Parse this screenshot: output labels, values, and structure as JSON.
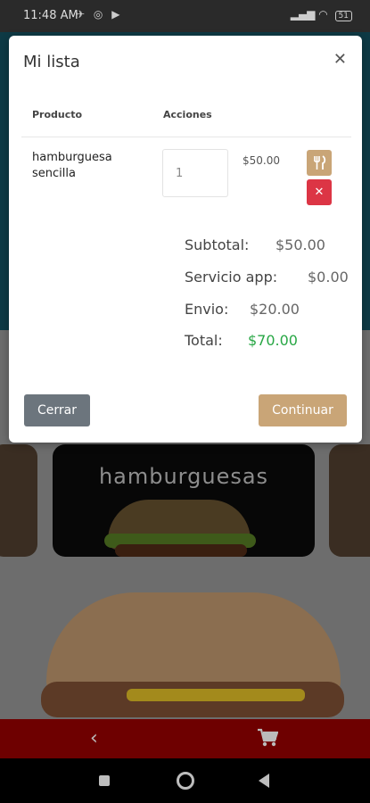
{
  "status_bar": {
    "time": "11:48 AM",
    "icons": [
      "bluetooth-off-icon",
      "whatsapp-icon",
      "youtube-icon"
    ],
    "battery": "51"
  },
  "background": {
    "category_title": "hamburguesas"
  },
  "modal": {
    "title": "Mi lista",
    "columns": [
      "Producto",
      "Acciones"
    ],
    "items": [
      {
        "name": "hamburguesa sencilla",
        "quantity": "1",
        "price": "$50.00",
        "actions": [
          "utensils-icon",
          "delete-icon"
        ]
      }
    ],
    "summary": {
      "subtotal_label": "Subtotal:",
      "subtotal_value": "$50.00",
      "service_label": "Servicio app:",
      "service_value": "$0.00",
      "shipping_label": "Envio:",
      "shipping_value": "$20.00",
      "total_label": "Total:",
      "total_value": "$70.00"
    },
    "buttons": {
      "close": "Cerrar",
      "continue": "Continuar"
    }
  },
  "colors": {
    "accent": "#c9a577",
    "danger": "#dc3545",
    "secondary": "#6c757d",
    "total": "#28a745",
    "nav_bar": "#6e0000"
  }
}
